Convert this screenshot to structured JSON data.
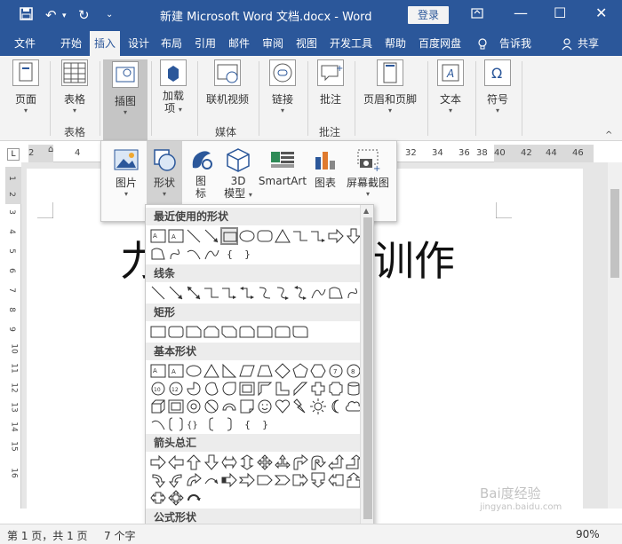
{
  "titlebar": {
    "title": "新建 Microsoft Word 文档.docx  -  Word",
    "login": "登录",
    "icons": [
      "save-icon",
      "undo-icon",
      "redo-icon",
      "customize-icon",
      "ribbon-display-icon",
      "minimize-icon",
      "maximize-icon",
      "close-icon"
    ]
  },
  "tabs": [
    "文件",
    "开始",
    "插入",
    "设计",
    "布局",
    "引用",
    "邮件",
    "审阅",
    "视图",
    "开发工具",
    "帮助",
    "百度网盘"
  ],
  "active_tab": "插入",
  "tell_me": "告诉我",
  "share": "共享",
  "ribbon": {
    "page": "页面",
    "table": "表格",
    "illustrations": "插图",
    "addins": "加载\n项",
    "online_video": "联机视频",
    "link": "链接",
    "comment": "批注",
    "header_footer": "页眉和页脚",
    "text": "文本",
    "symbol": "符号",
    "groups": {
      "table": "表格",
      "media": "媒体",
      "comment": "批注"
    }
  },
  "illus_popup": {
    "picture": "图片",
    "shapes": "形状",
    "icons": "图\n标",
    "model3d": "3D\n模型",
    "smartart": "SmartArt",
    "chart": "图表",
    "screenshot": "屏幕截图"
  },
  "shapes_gallery": {
    "sections": [
      "最近使用的形状",
      "线条",
      "矩形",
      "基本形状",
      "箭头总汇",
      "公式形状"
    ]
  },
  "ruler": {
    "h_numbers": [
      "2",
      "2",
      "4",
      "32",
      "34",
      "36",
      "38",
      "40",
      "42",
      "44",
      "46",
      "48"
    ],
    "v_numbers": [
      "1",
      "2",
      "3",
      "4",
      "5",
      "6",
      "7",
      "8",
      "9",
      "10",
      "11",
      "12",
      "13",
      "14",
      "15",
      "16"
    ]
  },
  "document": {
    "text_left": "力",
    "text_right": "训作"
  },
  "statusbar": {
    "page": "第 1 页，共 1 页",
    "words": "7 个字",
    "zoom": "90%"
  },
  "watermark": "Bai度经验\njingyan.baidu.com"
}
